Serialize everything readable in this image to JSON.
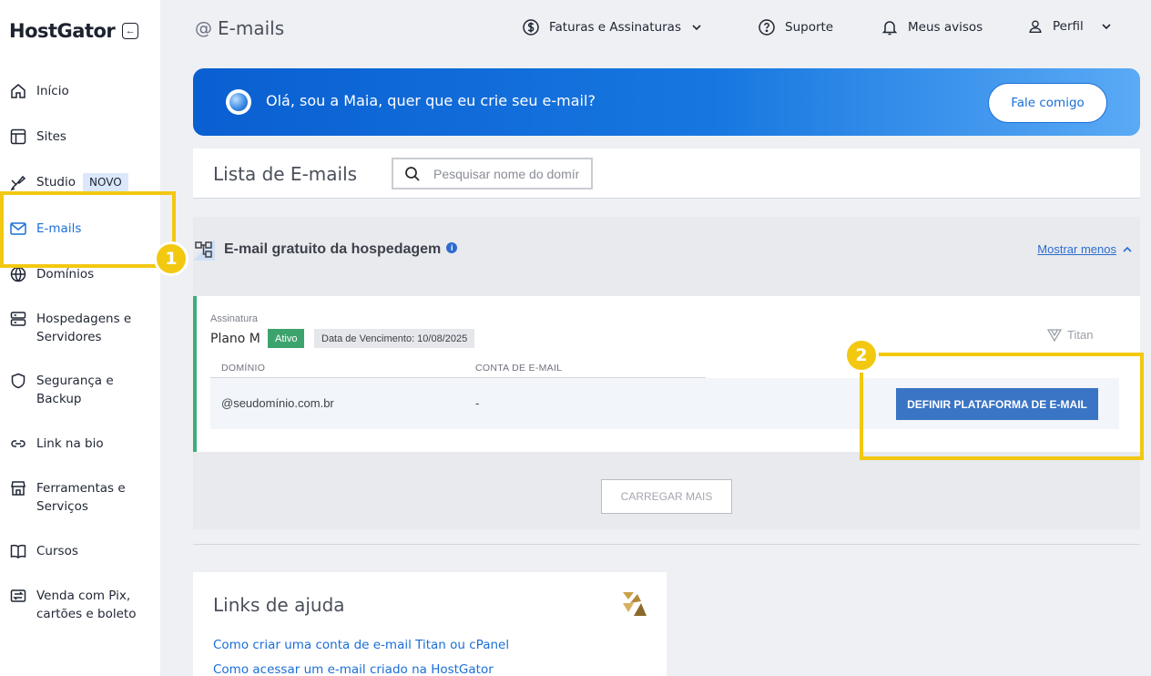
{
  "brand": {
    "name": "HostGator"
  },
  "sidebar": {
    "items": [
      {
        "label": "Início"
      },
      {
        "label": "Sites"
      },
      {
        "label": "Studio",
        "badge": "NOVO"
      },
      {
        "label": "E-mails",
        "active": true
      },
      {
        "label": "Domínios"
      },
      {
        "label": "Hospedagens e Servidores"
      },
      {
        "label": "Segurança e Backup"
      },
      {
        "label": "Link na bio"
      },
      {
        "label": "Ferramentas e Serviços"
      },
      {
        "label": "Cursos"
      },
      {
        "label": "Venda com Pix, cartões e boleto"
      }
    ]
  },
  "header": {
    "title_icon": "@",
    "title": "E-mails",
    "billing": "Faturas e Assinaturas",
    "support": "Suporte",
    "notices": "Meus avisos",
    "profile": "Perfil"
  },
  "banner": {
    "text": "Olá, sou a Maia, quer que eu crie seu e-mail?",
    "button": "Fale comigo"
  },
  "list": {
    "title": "Lista de E-mails",
    "search_placeholder": "Pesquisar nome do domínio"
  },
  "section": {
    "title": "E-mail gratuito da hospedagem",
    "toggle": "Mostrar menos",
    "subscription_label": "Assinatura",
    "plan": "Plano M",
    "status": "Ativo",
    "due": "Data de Vencimento: 10/08/2025",
    "platform": "Titan",
    "columns": [
      "DOMÍNIO",
      "CONTA DE E-MAIL"
    ],
    "row": {
      "domain": "@seudomínio.com.br",
      "account": "-"
    },
    "define_button": "DEFINIR PLATAFORMA DE E-MAIL",
    "load_more": "CARREGAR MAIS"
  },
  "help": {
    "title": "Links de ajuda",
    "links": [
      "Como criar uma conta de e-mail Titan ou cPanel",
      "Como acessar um e-mail criado na HostGator"
    ]
  },
  "annotations": {
    "step1": "1",
    "step2": "2"
  },
  "colors": {
    "accent": "#1a6ed8",
    "highlight": "#f2c811",
    "active_green": "#3da36c"
  }
}
